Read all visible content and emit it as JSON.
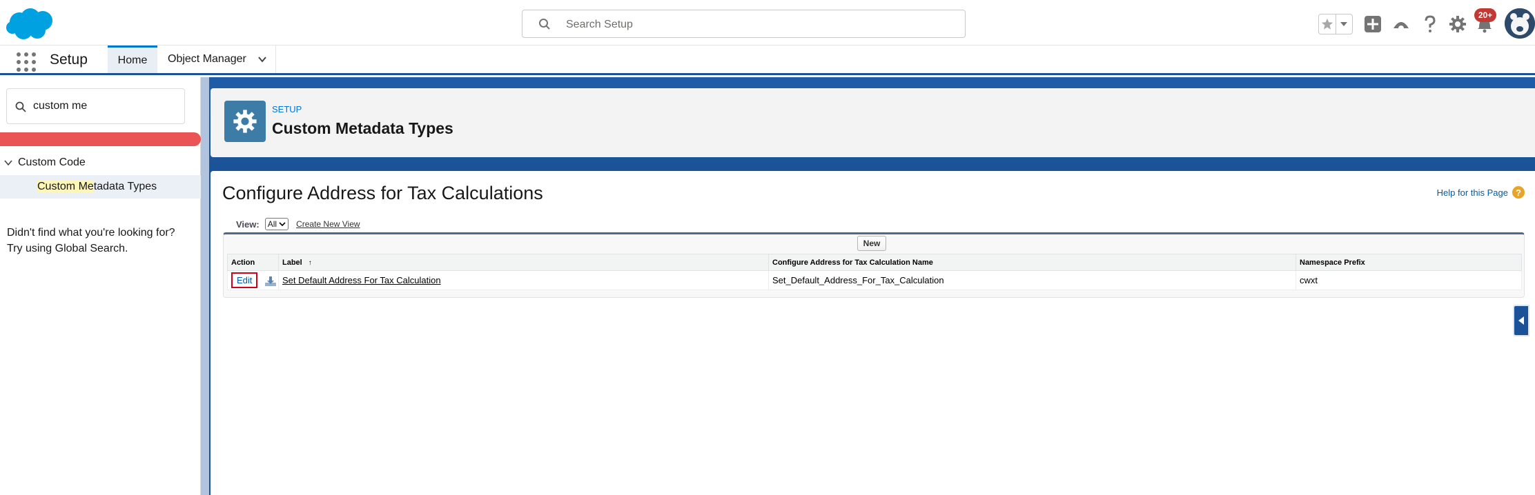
{
  "header": {
    "search_placeholder": "Search Setup",
    "notification_badge": "20+",
    "icons": [
      "salesforce-cloud-logo",
      "search-icon",
      "star-icon",
      "chevron-down-icon",
      "plus-icon",
      "trailhead-icon",
      "help-icon",
      "gear-icon",
      "bell-icon",
      "avatar"
    ]
  },
  "nav": {
    "app_name": "Setup",
    "tabs": [
      {
        "label": "Home",
        "active": true
      },
      {
        "label": "Object Manager",
        "active": false
      }
    ]
  },
  "sidebar": {
    "quick_find_value": "custom me",
    "tree_parent": "Custom Code",
    "tree_child_highlight": "Custom Me",
    "tree_child_rest": "tadata Types",
    "not_found_line1": "Didn't find what you're looking for?",
    "not_found_line2": "Try using Global Search."
  },
  "page_header": {
    "eyebrow": "SETUP",
    "title": "Custom Metadata Types"
  },
  "content": {
    "title": "Configure Address for Tax Calculations",
    "help_link": "Help for this Page",
    "view_label": "View:",
    "view_value": "All",
    "create_view_link": "Create New View",
    "new_button": "New",
    "columns": [
      "Action",
      "Label",
      "Configure Address for Tax Calculation Name",
      "Namespace Prefix"
    ],
    "sort_indicator": "↑",
    "rows": [
      {
        "action": "Edit",
        "label": "Set Default Address For Tax Calculation",
        "name": "Set_Default_Address_For_Tax_Calculation",
        "namespace": "cwxt"
      }
    ]
  },
  "colors": {
    "brand_blue": "#0176d3",
    "header_band": "#1b5297",
    "alert_red": "#ea5454",
    "badge_red": "#c23934"
  }
}
